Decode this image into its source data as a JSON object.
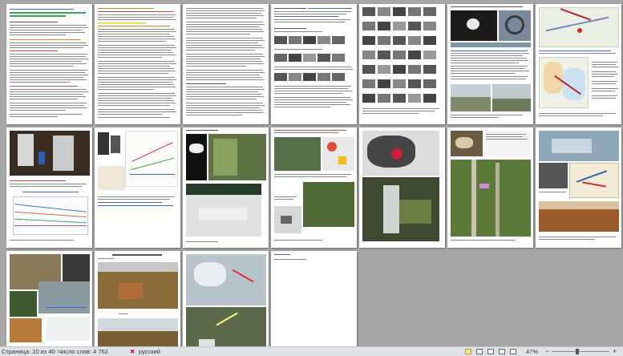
{
  "status": {
    "page_info": "Страница: 10 из 40",
    "word_count": "Число слов: 4 762",
    "language": "русский",
    "zoom": "47%",
    "zoom_out": "−",
    "zoom_in": "+"
  },
  "colors": {
    "background": "#a6a6a6",
    "page": "#ffffff",
    "statusbar": "#dfe3e8"
  }
}
